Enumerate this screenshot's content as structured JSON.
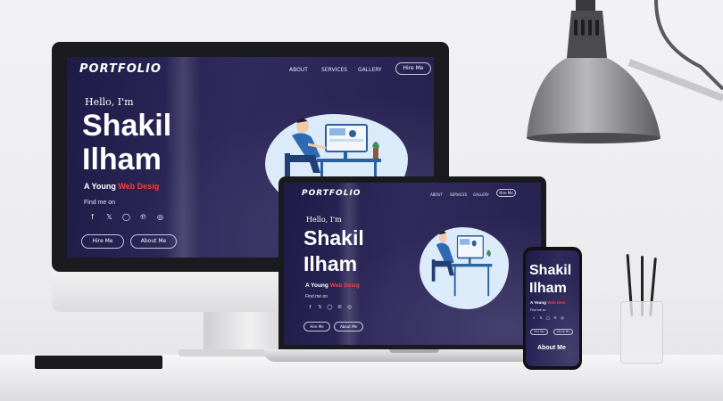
{
  "site": {
    "logo": "PORTFOLIO",
    "nav": [
      "ABOUT",
      "SERVICES",
      "GALLERY"
    ],
    "nav_cta": "Hire Me",
    "greeting": "Hello, I'm",
    "first_name": "Shakil",
    "last_name": "Ilham",
    "tagline_prefix": "A Young ",
    "tagline_highlight_monitor": "Web Desig",
    "tagline_highlight_laptop": "Web Desig",
    "tagline_highlight_phone": "Web Desi",
    "find_me": "Find me on",
    "primary_button": "Hire Me",
    "secondary_button": "About Me",
    "phone_section_heading": "About Me",
    "social_icons": [
      "facebook-icon",
      "twitter-icon",
      "instagram-icon",
      "pinterest-icon",
      "dribbble-icon"
    ],
    "colors": {
      "background": "#26214e",
      "accent": "#ff3b3b",
      "blob": "#dcebfa"
    }
  }
}
